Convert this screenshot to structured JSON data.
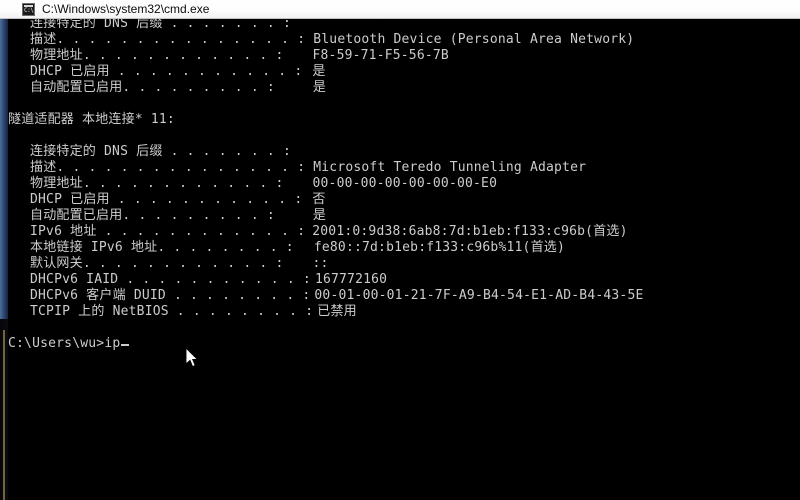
{
  "window": {
    "title": "C:\\Windows\\system32\\cmd.exe",
    "icon": "cmd-icon",
    "icon_glyph": "C:\\",
    "background_color": "#000000",
    "text_color": "#cccccc",
    "titlebar_color": "#ffffff",
    "border_color": "#2f4a74"
  },
  "console": {
    "blocks": [
      {
        "id": "bluetooth-adapter-details",
        "rows": [
          {
            "label": "连接特定的 DNS 后缀",
            "dots": " . . . . . . . :",
            "value": ""
          },
          {
            "label": "描述",
            "dots": ". . . . . . . . . . . . . . . :",
            "value": "Bluetooth Device (Personal Area Network)"
          },
          {
            "label": "物理地址",
            "dots": ". . . . . . . . . . . . :",
            "value": "F8-59-71-F5-56-7B"
          },
          {
            "label": "DHCP 已启用",
            "dots": " . . . . . . . . . . . :",
            "value": "是"
          },
          {
            "label": "自动配置已启用",
            "dots": ". . . . . . . . . :",
            "value": "是"
          }
        ]
      },
      {
        "id": "teredo-tunnel-adapter",
        "heading": "隧道适配器 本地连接* 11:",
        "rows": [
          {
            "label": "连接特定的 DNS 后缀",
            "dots": " . . . . . . . :",
            "value": ""
          },
          {
            "label": "描述",
            "dots": ". . . . . . . . . . . . . . . :",
            "value": "Microsoft Teredo Tunneling Adapter"
          },
          {
            "label": "物理地址",
            "dots": ". . . . . . . . . . . . :",
            "value": "00-00-00-00-00-00-00-E0"
          },
          {
            "label": "DHCP 已启用",
            "dots": " . . . . . . . . . . . :",
            "value": "否"
          },
          {
            "label": "自动配置已启用",
            "dots": ". . . . . . . . . :",
            "value": "是"
          },
          {
            "label": "IPv6 地址",
            "dots": " . . . . . . . . . . . . :",
            "value": "2001:0:9d38:6ab8:7d:b1eb:f133:c96b(首选)"
          },
          {
            "label": "本地链接 IPv6 地址",
            "dots": ". . . . . . . . :",
            "value": "fe80::7d:b1eb:f133:c96b%11(首选)"
          },
          {
            "label": "默认网关",
            "dots": ". . . . . . . . . . . . :",
            "value": "::"
          },
          {
            "label": "DHCPv6 IAID",
            "dots": " . . . . . . . . . . . :",
            "value": "167772160"
          },
          {
            "label": "DHCPv6 客户端 DUID",
            "dots": " . . . . . . . . :",
            "value": "00-01-00-01-21-7F-A9-B4-54-E1-AD-B4-43-5E"
          },
          {
            "label": "TCPIP 上的 NetBIOS",
            "dots": " . . . . . . . . :",
            "value": "已禁用"
          }
        ]
      }
    ],
    "prompt": {
      "path": "C:\\Users\\wu>",
      "typed_command": "ip"
    }
  }
}
